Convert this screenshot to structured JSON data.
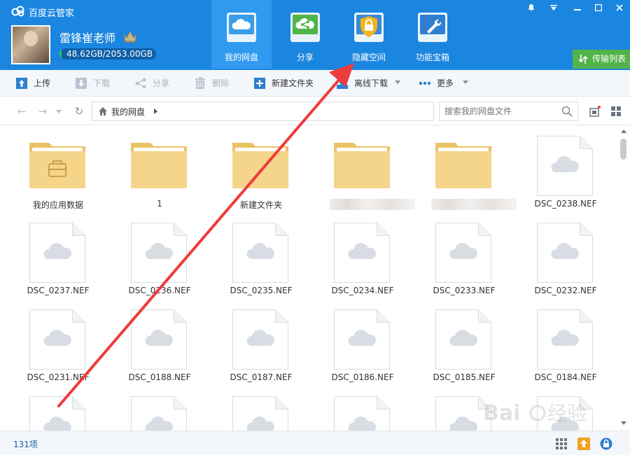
{
  "app": {
    "title": "百度云管家"
  },
  "user": {
    "name": "雷锋崔老师",
    "quota_text": "48.62GB/2053.00GB",
    "quota_fraction": 0.024
  },
  "nav": {
    "tabs": [
      {
        "label": "我的网盘",
        "icon": "cloud-drive-icon",
        "active": true
      },
      {
        "label": "分享",
        "icon": "share-icon",
        "active": false
      },
      {
        "label": "隐藏空间",
        "icon": "lock-icon",
        "active": false
      },
      {
        "label": "功能宝箱",
        "icon": "toolbox-icon",
        "active": false
      }
    ],
    "transfer_label": "传输列表"
  },
  "toolbar": {
    "upload": "上传",
    "download": "下载",
    "share": "分享",
    "delete": "删除",
    "new_folder": "新建文件夹",
    "offline_download": "离线下载",
    "more": "更多"
  },
  "address": {
    "breadcrumb": "我的网盘",
    "search_placeholder": "搜索我的网盘文件"
  },
  "files": [
    {
      "name": "我的应用数据",
      "type": "app-folder"
    },
    {
      "name": "1",
      "type": "folder"
    },
    {
      "name": "新建文件夹",
      "type": "folder"
    },
    {
      "name": "",
      "type": "folder",
      "blurred": true
    },
    {
      "name": "",
      "type": "folder",
      "blurred": true
    },
    {
      "name": "DSC_0238.NEF",
      "type": "file"
    },
    {
      "name": "DSC_0237.NEF",
      "type": "file"
    },
    {
      "name": "DSC_0236.NEF",
      "type": "file"
    },
    {
      "name": "DSC_0235.NEF",
      "type": "file"
    },
    {
      "name": "DSC_0234.NEF",
      "type": "file"
    },
    {
      "name": "DSC_0233.NEF",
      "type": "file"
    },
    {
      "name": "DSC_0232.NEF",
      "type": "file"
    },
    {
      "name": "DSC_0231.NEF",
      "type": "file"
    },
    {
      "name": "DSC_0188.NEF",
      "type": "file"
    },
    {
      "name": "DSC_0187.NEF",
      "type": "file"
    },
    {
      "name": "DSC_0186.NEF",
      "type": "file"
    },
    {
      "name": "DSC_0185.NEF",
      "type": "file"
    },
    {
      "name": "DSC_0184.NEF",
      "type": "file"
    },
    {
      "name": "",
      "type": "file"
    },
    {
      "name": "",
      "type": "file"
    },
    {
      "name": "",
      "type": "file"
    },
    {
      "name": "",
      "type": "file"
    },
    {
      "name": "",
      "type": "file"
    },
    {
      "name": "",
      "type": "file"
    }
  ],
  "status": {
    "item_count": "131项"
  },
  "colors": {
    "header": "#1b86e0",
    "active_tab": "#2f9af0",
    "accent_green": "#52b34a",
    "annotation": "#ee3b3b",
    "folder": "#f5d58a"
  }
}
